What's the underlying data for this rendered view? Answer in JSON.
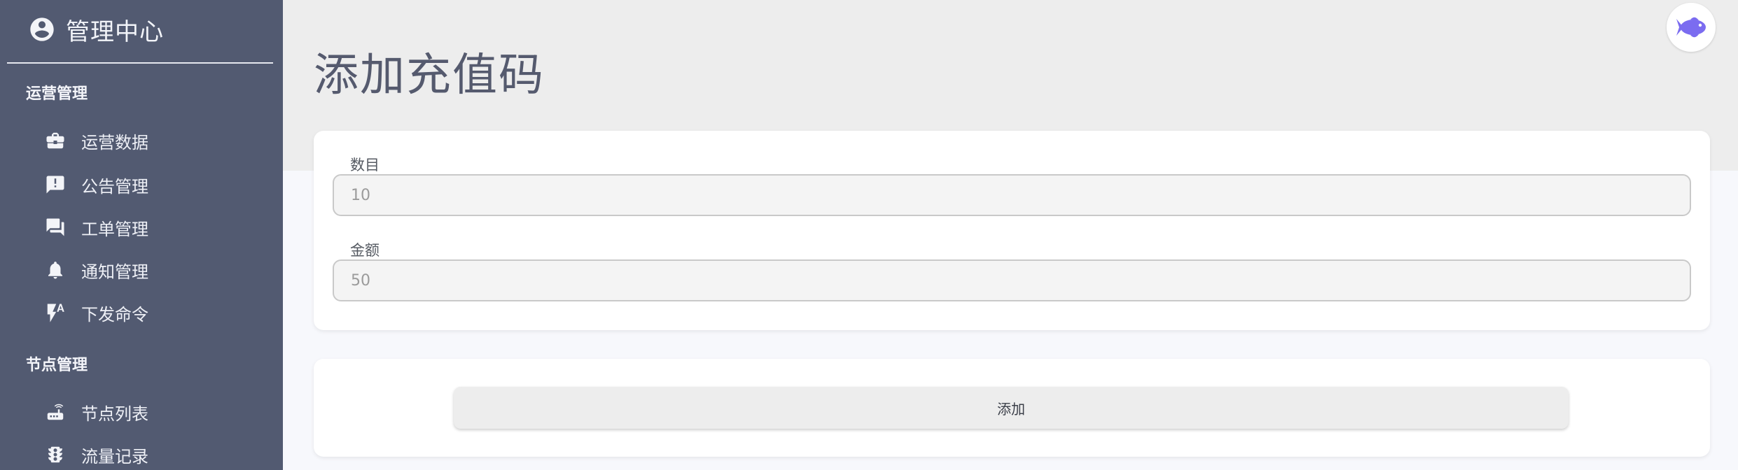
{
  "sidebar": {
    "brand": {
      "title": "管理中心",
      "icon": "account-circle-icon"
    },
    "sections": [
      {
        "title": "运营管理",
        "items": [
          {
            "label": "运营数据",
            "icon": "briefcase-icon"
          },
          {
            "label": "公告管理",
            "icon": "announcement-icon"
          },
          {
            "label": "工单管理",
            "icon": "forum-icon"
          },
          {
            "label": "通知管理",
            "icon": "bell-icon"
          },
          {
            "label": "下发命令",
            "icon": "flash-auto-icon"
          }
        ]
      },
      {
        "title": "节点管理",
        "items": [
          {
            "label": "节点列表",
            "icon": "router-icon"
          },
          {
            "label": "流量记录",
            "icon": "traffic-light-icon"
          }
        ]
      }
    ]
  },
  "header": {
    "title": "添加充值码",
    "avatar_icon": "fish-icon",
    "avatar_color": "#7b6cf0"
  },
  "form": {
    "count": {
      "label": "数目",
      "placeholder": "10"
    },
    "amount": {
      "label": "金额",
      "placeholder": "50"
    }
  },
  "actions": {
    "add_label": "添加"
  },
  "colors": {
    "sidebar_bg": "#525a71",
    "header_bg": "#ededed",
    "page_bg": "#f7f8fc"
  }
}
